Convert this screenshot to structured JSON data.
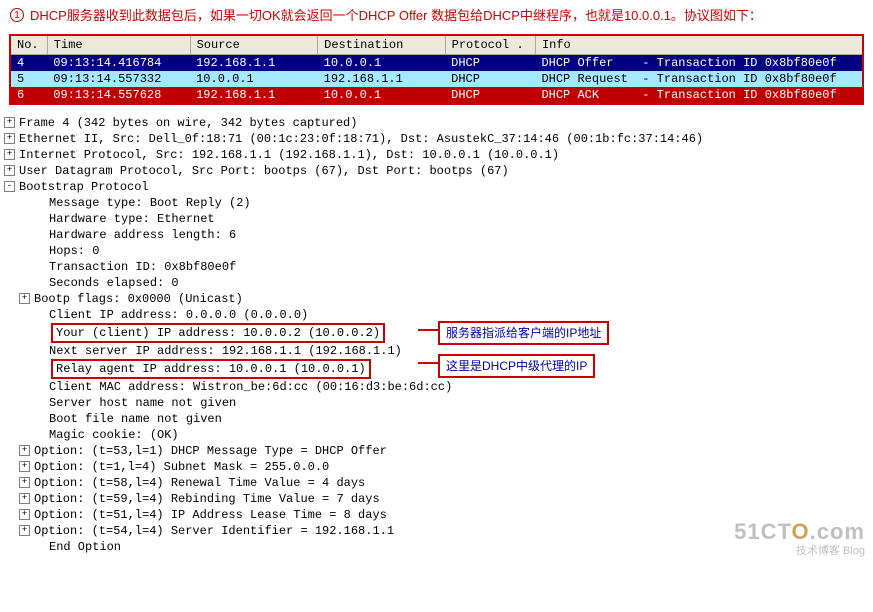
{
  "note": {
    "bullet": "1",
    "text": "DHCP服务器收到此数据包后，如果一切OK就会返回一个DHCP Offer 数据包给DHCP中继程序，也就是10.0.0.1。协议图如下："
  },
  "table": {
    "headers": [
      "No.",
      "Time",
      "Source",
      "Destination",
      "Protocol .",
      "Info"
    ],
    "rows": [
      {
        "cls": "row-sel",
        "c": [
          "4",
          "09:13:14.416784",
          "192.168.1.1",
          "10.0.0.1",
          "DHCP",
          "DHCP Offer    - Transaction ID 0x8bf80e0f"
        ]
      },
      {
        "cls": "row-hl",
        "c": [
          "5",
          "09:13:14.557332",
          "10.0.0.1",
          "192.168.1.1",
          "DHCP",
          "DHCP Request  - Transaction ID 0x8bf80e0f"
        ]
      },
      {
        "cls": "row-red",
        "c": [
          "6",
          "09:13:14.557628",
          "192.168.1.1",
          "10.0.0.1",
          "DHCP",
          "DHCP ACK      - Transaction ID 0x8bf80e0f"
        ]
      }
    ]
  },
  "tree": [
    {
      "t": "+",
      "i": 0,
      "x": "Frame 4 (342 bytes on wire, 342 bytes captured)"
    },
    {
      "t": "+",
      "i": 0,
      "x": "Ethernet II, Src: Dell_0f:18:71 (00:1c:23:0f:18:71), Dst: AsustekC_37:14:46 (00:1b:fc:37:14:46)"
    },
    {
      "t": "+",
      "i": 0,
      "x": "Internet Protocol, Src: 192.168.1.1 (192.168.1.1), Dst: 10.0.0.1 (10.0.0.1)"
    },
    {
      "t": "+",
      "i": 0,
      "x": "User Datagram Protocol, Src Port: bootps (67), Dst Port: bootps (67)"
    },
    {
      "t": "-",
      "i": 0,
      "x": "Bootstrap Protocol"
    },
    {
      "t": "",
      "i": 2,
      "x": "Message type: Boot Reply (2)"
    },
    {
      "t": "",
      "i": 2,
      "x": "Hardware type: Ethernet"
    },
    {
      "t": "",
      "i": 2,
      "x": "Hardware address length: 6"
    },
    {
      "t": "",
      "i": 2,
      "x": "Hops: 0"
    },
    {
      "t": "",
      "i": 2,
      "x": "Transaction ID: 0x8bf80e0f"
    },
    {
      "t": "",
      "i": 2,
      "x": "Seconds elapsed: 0"
    },
    {
      "t": "+",
      "i": 1,
      "x": "Bootp flags: 0x0000 (Unicast)"
    },
    {
      "t": "",
      "i": 2,
      "x": "Client IP address: 0.0.0.0 (0.0.0.0)"
    },
    {
      "t": "",
      "i": 2,
      "x": "Your (client) IP address: 10.0.0.2 (10.0.0.2)",
      "box": true
    },
    {
      "t": "",
      "i": 2,
      "x": "Next server IP address: 192.168.1.1 (192.168.1.1)"
    },
    {
      "t": "",
      "i": 2,
      "x": "Relay agent IP address: 10.0.0.1 (10.0.0.1)",
      "box": true
    },
    {
      "t": "",
      "i": 2,
      "x": "Client MAC address: Wistron_be:6d:cc (00:16:d3:be:6d:cc)"
    },
    {
      "t": "",
      "i": 2,
      "x": "Server host name not given"
    },
    {
      "t": "",
      "i": 2,
      "x": "Boot file name not given"
    },
    {
      "t": "",
      "i": 2,
      "x": "Magic cookie: (OK)"
    },
    {
      "t": "+",
      "i": 1,
      "x": "Option: (t=53,l=1) DHCP Message Type = DHCP Offer"
    },
    {
      "t": "+",
      "i": 1,
      "x": "Option: (t=1,l=4) Subnet Mask = 255.0.0.0"
    },
    {
      "t": "+",
      "i": 1,
      "x": "Option: (t=58,l=4) Renewal Time Value = 4 days"
    },
    {
      "t": "+",
      "i": 1,
      "x": "Option: (t=59,l=4) Rebinding Time Value = 7 days"
    },
    {
      "t": "+",
      "i": 1,
      "x": "Option: (t=51,l=4) IP Address Lease Time = 8 days"
    },
    {
      "t": "+",
      "i": 1,
      "x": "Option: (t=54,l=4) Server Identifier = 192.168.1.1"
    },
    {
      "t": "",
      "i": 2,
      "x": "End Option"
    }
  ],
  "callouts": {
    "a": "服务器指派给客户端的IP地址",
    "b": "这里是DHCP中级代理的IP"
  },
  "watermark": {
    "big_pre": "51CT",
    "big_o": "O",
    "big_post": ".com",
    "sub": "技术博客   Blog"
  }
}
